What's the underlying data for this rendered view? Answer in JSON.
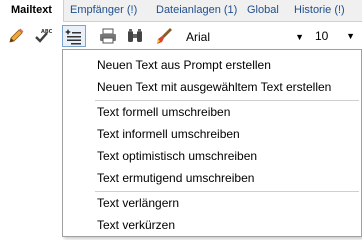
{
  "tabs": [
    {
      "label": "Mailtext",
      "active": true
    },
    {
      "label": "Empfänger (!)",
      "active": false
    },
    {
      "label": "Dateianlagen (1)",
      "active": false
    },
    {
      "label": "Global",
      "active": false
    },
    {
      "label": "Historie (!)",
      "active": false
    }
  ],
  "toolbar": {
    "icons": [
      "pencil-icon",
      "spellcheck-icon",
      "ai-text-icon",
      "print-icon",
      "binoculars-icon",
      "brush-icon"
    ],
    "font": {
      "value": "Arial"
    },
    "size": {
      "value": "10"
    }
  },
  "menu": {
    "groups": [
      [
        "Neuen Text aus Prompt erstellen",
        "Neuen Text mit ausgewähltem Text erstellen"
      ],
      [
        "Text formell umschreiben",
        "Text informell umschreiben",
        "Text optimistisch umschreiben",
        "Text ermutigend umschreiben"
      ],
      [
        "Text verlängern",
        "Text verkürzen"
      ]
    ]
  },
  "colors": {
    "tab_text": "#1f4f8c",
    "tabbar_bg": "#f0f0f0",
    "active_button_bg": "#e8f0fa",
    "active_button_border": "#7da2ce"
  }
}
